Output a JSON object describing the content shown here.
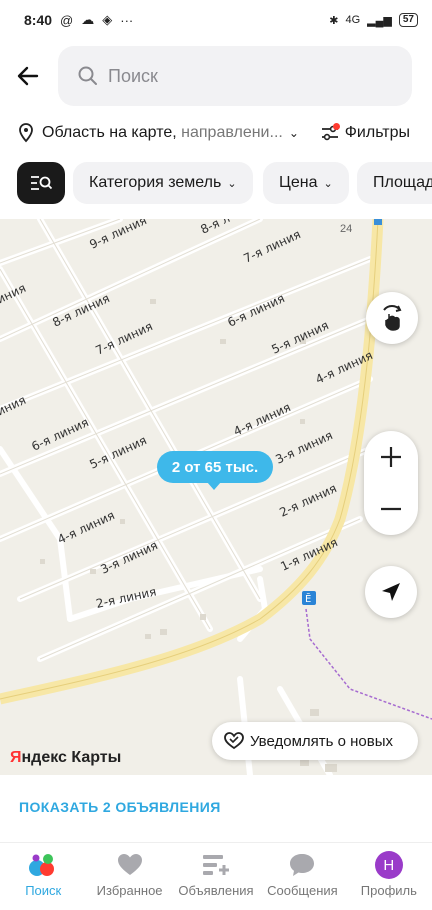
{
  "status_bar": {
    "time": "8:40",
    "battery": "57",
    "network": "4G"
  },
  "header": {
    "search_placeholder": "Поиск"
  },
  "location": {
    "label": "Область на карте,",
    "detail": "направлени..."
  },
  "filters": {
    "label": "Фильтры"
  },
  "chips": [
    "Категория земель",
    "Цена",
    "Площадь"
  ],
  "map": {
    "price_bubble": "2 от 65 тыс.",
    "notify_label": "Уведомлять о новых",
    "logo_ya": "Я",
    "logo_rest": "ндекс Карты",
    "house_number": "24",
    "streets": [
      "9-я линия",
      "8-я л",
      "7-я линия",
      "8-я линия",
      "6-я линия",
      "7-я линия",
      "5-я линия",
      "6-я линия",
      "4-я линия",
      "4-я линия",
      "5-я линия",
      "3-я линия",
      "4-я линия",
      "3-я линия",
      "2-я линия",
      "2-я линия",
      "1-я линия",
      "линия",
      "линия"
    ]
  },
  "show_listings": "ПОКАЗАТЬ 2 ОБЪЯВЛЕНИЯ",
  "bottom_nav": [
    {
      "label": "Поиск",
      "icon": "search-dots-icon",
      "active": true
    },
    {
      "label": "Избранное",
      "icon": "heart-icon",
      "active": false
    },
    {
      "label": "Объявления",
      "icon": "listings-add-icon",
      "active": false
    },
    {
      "label": "Сообщения",
      "icon": "chat-icon",
      "active": false
    },
    {
      "label": "Профиль",
      "icon": "avatar-icon",
      "avatar_letter": "Н",
      "active": false
    }
  ],
  "colors": {
    "accent": "#2fa8e0",
    "bubble": "#3eb8ea",
    "road": "#f7e7a6",
    "map_bg": "#f1efe8",
    "avatar": "#9a3bc9"
  }
}
